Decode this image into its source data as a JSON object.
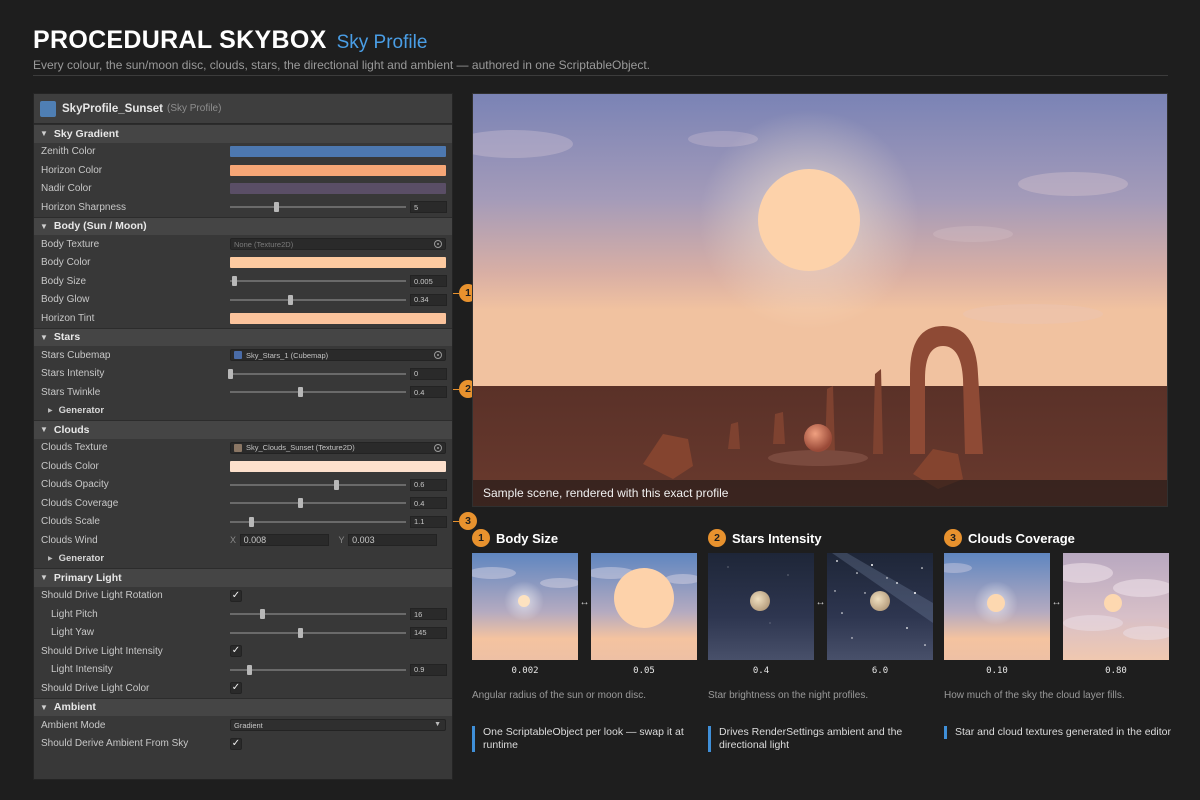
{
  "header": {
    "title": "PROCEDURAL SKYBOX",
    "subtitle": "Sky Profile",
    "description": "Every colour, the sun/moon disc, clouds, stars, the directional light and ambient — authored in one ScriptableObject."
  },
  "inspector": {
    "asset_name": "SkyProfile_Sunset",
    "asset_type": "(Sky Profile)",
    "sky_gradient": {
      "header": "Sky Gradient",
      "zenith_label": "Zenith Color",
      "zenith_color": "#4d78b0",
      "horizon_label": "Horizon Color",
      "horizon_color": "#f6a676",
      "nadir_label": "Nadir Color",
      "nadir_color": "#5a4e66",
      "sharpness_label": "Horizon Sharpness",
      "sharpness_fraction": 0.26,
      "sharpness_value": "5"
    },
    "body": {
      "header": "Body (Sun / Moon)",
      "texture_label": "Body Texture",
      "texture_value": "None (Texture2D)",
      "color_label": "Body Color",
      "color": "#fdcaa0",
      "size_label": "Body Size",
      "size_fraction": 0.02,
      "size_value": "0.005",
      "glow_label": "Body Glow",
      "glow_fraction": 0.34,
      "glow_value": "0.34",
      "tint_label": "Horizon Tint",
      "tint_color": "#fbc39c"
    },
    "stars": {
      "header": "Stars",
      "cubemap_label": "Stars Cubemap",
      "cubemap_value": "Sky_Stars_1 (Cubemap)",
      "cubemap_icon_color": "#4a6ca8",
      "intensity_label": "Stars Intensity",
      "intensity_fraction": 0.0,
      "intensity_value": "0",
      "twinkle_label": "Stars Twinkle",
      "twinkle_fraction": 0.4,
      "twinkle_value": "0.4",
      "generator_label": "Generator"
    },
    "clouds": {
      "header": "Clouds",
      "texture_label": "Clouds Texture",
      "texture_value": "Sky_Clouds_Sunset (Texture2D)",
      "texture_icon_color": "#8a7664",
      "color_label": "Clouds Color",
      "color": "#fde0cc",
      "opacity_label": "Clouds Opacity",
      "opacity_fraction": 0.6,
      "opacity_value": "0.6",
      "coverage_label": "Clouds Coverage",
      "coverage_fraction": 0.4,
      "coverage_value": "0.4",
      "scale_label": "Clouds Scale",
      "scale_fraction": 0.12,
      "scale_value": "1.1",
      "wind_label": "Clouds Wind",
      "wind_x_label": "X",
      "wind_x": "0.008",
      "wind_y_label": "Y",
      "wind_y": "0.003",
      "generator_label": "Generator"
    },
    "primary_light": {
      "header": "Primary Light",
      "drive_rotation_label": "Should Drive Light Rotation",
      "pitch_label": "Light Pitch",
      "pitch_fraction": 0.18,
      "pitch_value": "16",
      "yaw_label": "Light Yaw",
      "yaw_fraction": 0.4,
      "yaw_value": "145",
      "drive_intensity_label": "Should Drive Light Intensity",
      "intensity_label": "Light Intensity",
      "intensity_fraction": 0.11,
      "intensity_value": "0.9",
      "drive_color_label": "Should Drive Light Color",
      "check": "✓"
    },
    "ambient": {
      "header": "Ambient",
      "mode_label": "Ambient Mode",
      "mode_value": "Gradient",
      "derive_label": "Should Derive Ambient From Sky"
    }
  },
  "callouts": [
    "1",
    "2",
    "3"
  ],
  "preview": {
    "caption": "Sample scene, rendered with this exact profile"
  },
  "comparisons": [
    {
      "number": "1",
      "title": "Body Size",
      "left_value": "0.002",
      "right_value": "0.05",
      "description": "Angular radius of the sun or moon disc."
    },
    {
      "number": "2",
      "title": "Stars Intensity",
      "left_value": "0.4",
      "right_value": "6.0",
      "description": "Star brightness on the night profiles."
    },
    {
      "number": "3",
      "title": "Clouds Coverage",
      "left_value": "0.10",
      "right_value": "0.80",
      "description": "How much of the sky the cloud layer fills."
    }
  ],
  "notes": [
    "One ScriptableObject per look — swap it at runtime",
    "Drives RenderSettings ambient and the directional light",
    "Star and cloud textures generated in the editor"
  ],
  "colors": {
    "accent_orange": "#e8922e",
    "accent_blue": "#4a9ee6",
    "note_bar": "#3f8fd8"
  }
}
